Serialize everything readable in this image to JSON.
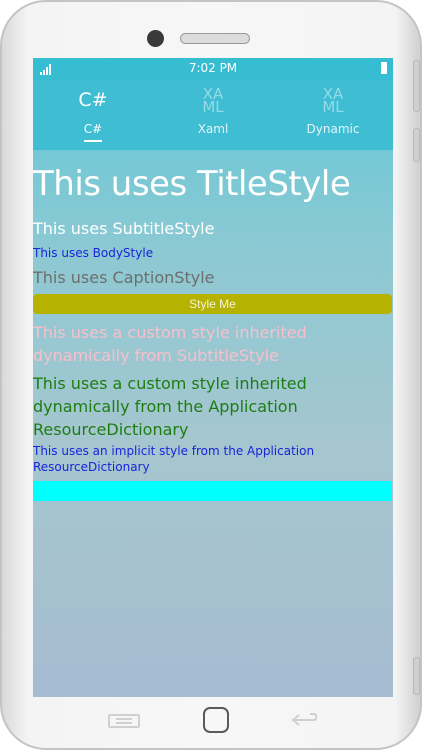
{
  "status_bar": {
    "time": "7:02 PM"
  },
  "tabs": [
    {
      "icon": "C#",
      "label": "C#",
      "active": true
    },
    {
      "icon": "XA\nML",
      "label": "Xaml",
      "active": false
    },
    {
      "icon": "XA\nML",
      "label": "Dynamic",
      "active": false
    }
  ],
  "content": {
    "title_text": "This uses TitleStyle",
    "subtitle_text": "This uses SubtitleStyle",
    "body_text": "This uses BodyStyle",
    "caption_text": "This uses CaptionStyle",
    "style_me_button_label": "Style Me",
    "custom_inherited_text": "This uses a custom style inherited dynamically from SubtitleStyle",
    "custom_app_text": "This uses a custom style inherited dynamically from the Application ResourceDictionary",
    "implicit_text": "This uses an implicit style from the Application ResourceDictionary",
    "cyan_entry_value": ""
  },
  "colors": {
    "tab_bar": "#3ebdd3",
    "status_bar": "#37bdd2",
    "body_text": "#1a24d8",
    "caption_text": "#6e6e6e",
    "button_bg": "#b5b300",
    "custom_inherited_text": "#f7c0cc",
    "custom_app_text": "#1e7d12",
    "cyan_bar": "#00ffff"
  }
}
